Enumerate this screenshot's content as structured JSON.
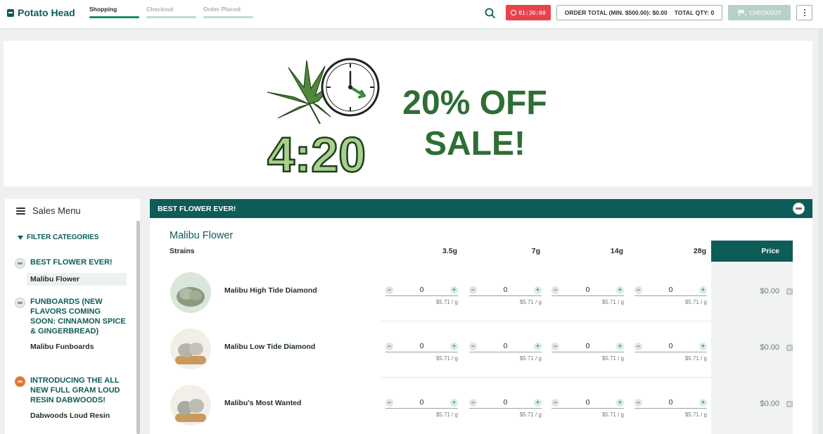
{
  "header": {
    "logo_text": "Potato Head",
    "steps": [
      {
        "label": "Shopping",
        "active": true
      },
      {
        "label": "Checkout",
        "active": false
      },
      {
        "label": "Order Placed",
        "active": false
      }
    ],
    "timer": "01:30:00",
    "order_total_label": "ORDER TOTAL (MIN. $500.00): $0.00",
    "total_qty_label": "TOTAL QTY: 0",
    "checkout_label": "CHECKOUT"
  },
  "banner": {
    "line1": "20% OFF",
    "line2": "SALE!",
    "art_text": "4:20"
  },
  "sidebar": {
    "title": "Sales Menu",
    "filter_label": "FILTER CATEGORIES",
    "categories": [
      {
        "name": "BEST FLOWER EVER!",
        "icon": "brand-logo-icon",
        "items": [
          "Malibu Flower"
        ]
      },
      {
        "name": "FUNBOARDS (NEW FLAVORS COMING SOON: CINNAMON SPICE & GINGERBREAD)",
        "icon": "brand-logo-icon",
        "items": [
          "Malibu Funboards"
        ]
      },
      {
        "name": "INTRODUCING THE ALL NEW FULL GRAM LOUD RESIN DABWOODS!",
        "icon": "dabwoods-logo-icon",
        "items": [
          "Dabwoods Loud Resin"
        ]
      }
    ]
  },
  "main": {
    "section_title": "BEST FLOWER EVER!",
    "product_title": "Malibu Flower",
    "columns": {
      "strains": "Strains",
      "sizes": [
        "3.5g",
        "7g",
        "14g",
        "28g"
      ],
      "price": "Price"
    },
    "rows": [
      {
        "strain": "Malibu High Tide Diamond",
        "qty": [
          "0",
          "0",
          "0",
          "0"
        ],
        "per_g": [
          "$5.71 / g",
          "$5.71 / g",
          "$5.71 / g",
          "$5.71 / g"
        ],
        "price": "$0.00"
      },
      {
        "strain": "Malibu Low Tide Diamond",
        "qty": [
          "0",
          "0",
          "0",
          "0"
        ],
        "per_g": [
          "$5.71 / g",
          "$5.71 / g",
          "$5.71 / g",
          "$5.71 / g"
        ],
        "price": "$0.00"
      },
      {
        "strain": "Malibu's Most Wanted",
        "qty": [
          "0",
          "0",
          "0",
          "0"
        ],
        "per_g": [
          "$5.71 / g",
          "$5.71 / g",
          "$5.71 / g",
          "$5.71 / g"
        ],
        "price": "$0.00"
      }
    ]
  },
  "colors": {
    "brand": "#0e5c57",
    "accent_green": "#1e8a64",
    "timer_red": "#e8434b",
    "sale_green": "#2e6e35"
  }
}
